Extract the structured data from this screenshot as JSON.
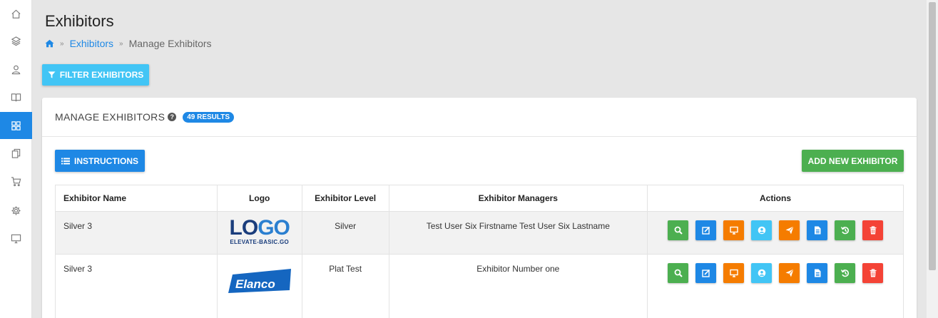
{
  "page": {
    "title": "Exhibitors",
    "breadcrumb": {
      "home_icon": "home-icon",
      "separator": "»",
      "link": "Exhibitors",
      "current": "Manage Exhibitors"
    }
  },
  "sidebar": {
    "items": [
      {
        "icon": "home-icon"
      },
      {
        "icon": "layers-icon"
      },
      {
        "icon": "user-icon"
      },
      {
        "icon": "book-icon"
      },
      {
        "icon": "grid-icon",
        "active": true
      },
      {
        "icon": "copy-icon"
      },
      {
        "icon": "cart-icon"
      },
      {
        "icon": "gear-icon"
      },
      {
        "icon": "monitor-icon"
      }
    ]
  },
  "filter_button": {
    "label": "FILTER EXHIBITORS",
    "icon": "filter-icon"
  },
  "panel": {
    "title": "MANAGE EXHIBITORS",
    "help_icon": "question-circle-icon",
    "results_badge": "49 RESULTS",
    "instructions_button": "INSTRUCTIONS",
    "add_button": "ADD NEW EXHIBITOR"
  },
  "table": {
    "headers": [
      "Exhibitor Name",
      "Logo",
      "Exhibitor Level",
      "Exhibitor Managers",
      "Actions"
    ],
    "rows": [
      {
        "name": "Silver 3",
        "logo_main": "LOGO",
        "logo_sub": "ELEVATE-BASIC.GO",
        "level": "Silver",
        "managers": "Test User Six Firstname Test User Six Lastname"
      },
      {
        "name": "Silver 3",
        "logo_main": "Elanco",
        "level": "Plat Test",
        "managers": "Exhibitor Number one"
      }
    ],
    "actions": [
      {
        "icon": "search-icon",
        "color": "#4caf50"
      },
      {
        "icon": "edit-icon",
        "color": "#1e88e5"
      },
      {
        "icon": "monitor-icon",
        "color": "#f57c00"
      },
      {
        "icon": "user-circle-icon",
        "color": "#42c5f5"
      },
      {
        "icon": "send-icon",
        "color": "#f57c00"
      },
      {
        "icon": "document-icon",
        "color": "#1e88e5"
      },
      {
        "icon": "history-icon",
        "color": "#4caf50"
      },
      {
        "icon": "trash-icon",
        "color": "#f44336"
      }
    ]
  },
  "colors": {
    "primary": "#1e88e5",
    "info": "#42c5f5",
    "success": "#4caf50",
    "warning": "#f57c00",
    "danger": "#f44336",
    "background": "#e6e6e6"
  }
}
